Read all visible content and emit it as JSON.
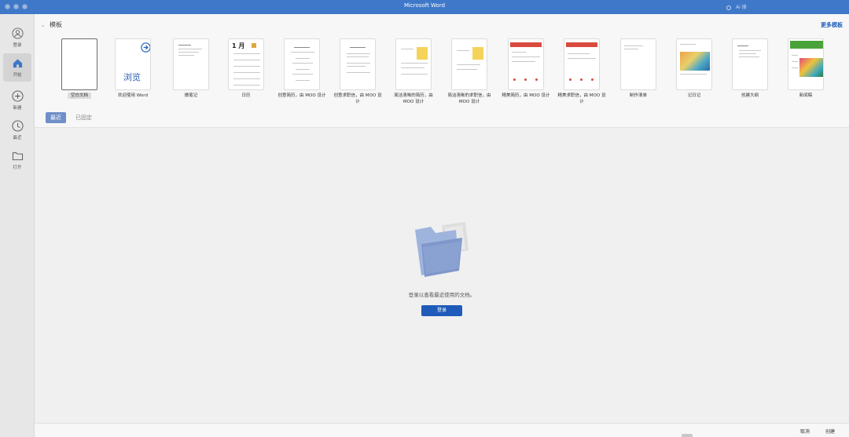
{
  "window": {
    "title": "Microsoft Word",
    "search_hint": "Ai 搜"
  },
  "sidebar": {
    "items": [
      {
        "label": "登录",
        "icon": "user-icon"
      },
      {
        "label": "开始",
        "icon": "home-icon",
        "active": true
      },
      {
        "label": "新建",
        "icon": "plus-circle-icon"
      },
      {
        "label": "最近",
        "icon": "clock-icon"
      },
      {
        "label": "打开",
        "icon": "folder-icon"
      }
    ]
  },
  "templates": {
    "heading": "模板",
    "more_label": "更多模板",
    "items": [
      {
        "label": "空白文档"
      },
      {
        "label": "欢迎使用 Word",
        "thumb_text": "浏览"
      },
      {
        "label": "做笔记"
      },
      {
        "label": "日历",
        "thumb_text": "1 月"
      },
      {
        "label": "创意简历，由 MOO 设计"
      },
      {
        "label": "创意求职信，由 MOO 设计"
      },
      {
        "label": "简洁清晰的简历，由 MOO 设计"
      },
      {
        "label": "简洁清晰的求职信，由 MOO 设计"
      },
      {
        "label": "精美简历，由 MOO 设计"
      },
      {
        "label": "精美求职信，由 MOO 设计"
      },
      {
        "label": "制作清单"
      },
      {
        "label": "记日记"
      },
      {
        "label": "创建大纲"
      },
      {
        "label": "新闻稿"
      }
    ]
  },
  "tabs": {
    "recent": "最近",
    "pinned": "已固定"
  },
  "empty_state": {
    "message": "登录以查看最近使用的文档。",
    "button": "登录"
  },
  "footer": {
    "cancel": "取消",
    "create": "创建"
  },
  "colors": {
    "titlebar": "#3f78c8",
    "accent": "#1f5bb8",
    "tab_active": "#6e8fc7",
    "link": "#1f5fbf"
  }
}
